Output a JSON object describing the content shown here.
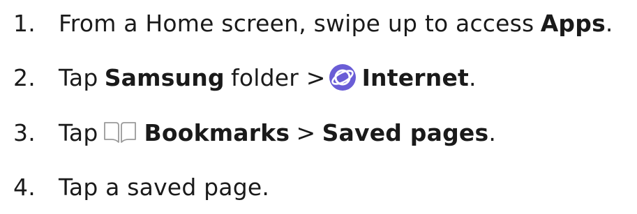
{
  "steps": [
    {
      "number": "1.",
      "parts": {
        "a": "From a Home screen, swipe up to access",
        "b": "Apps",
        "c": "."
      }
    },
    {
      "number": "2.",
      "parts": {
        "a": "Tap",
        "b": "Samsung",
        "c": "folder >",
        "icon": "internet-icon",
        "d": "Internet",
        "e": "."
      }
    },
    {
      "number": "3.",
      "parts": {
        "a": "Tap",
        "icon": "bookmarks-icon",
        "b": "Bookmarks",
        "c": ">",
        "d": "Saved pages",
        "e": "."
      }
    },
    {
      "number": "4.",
      "parts": {
        "a": "Tap a saved page."
      }
    }
  ],
  "colors": {
    "text": "#1a1a1a",
    "internet_icon_bg": "#6a5dd6",
    "bookmarks_icon_stroke": "#9a9a9a"
  }
}
